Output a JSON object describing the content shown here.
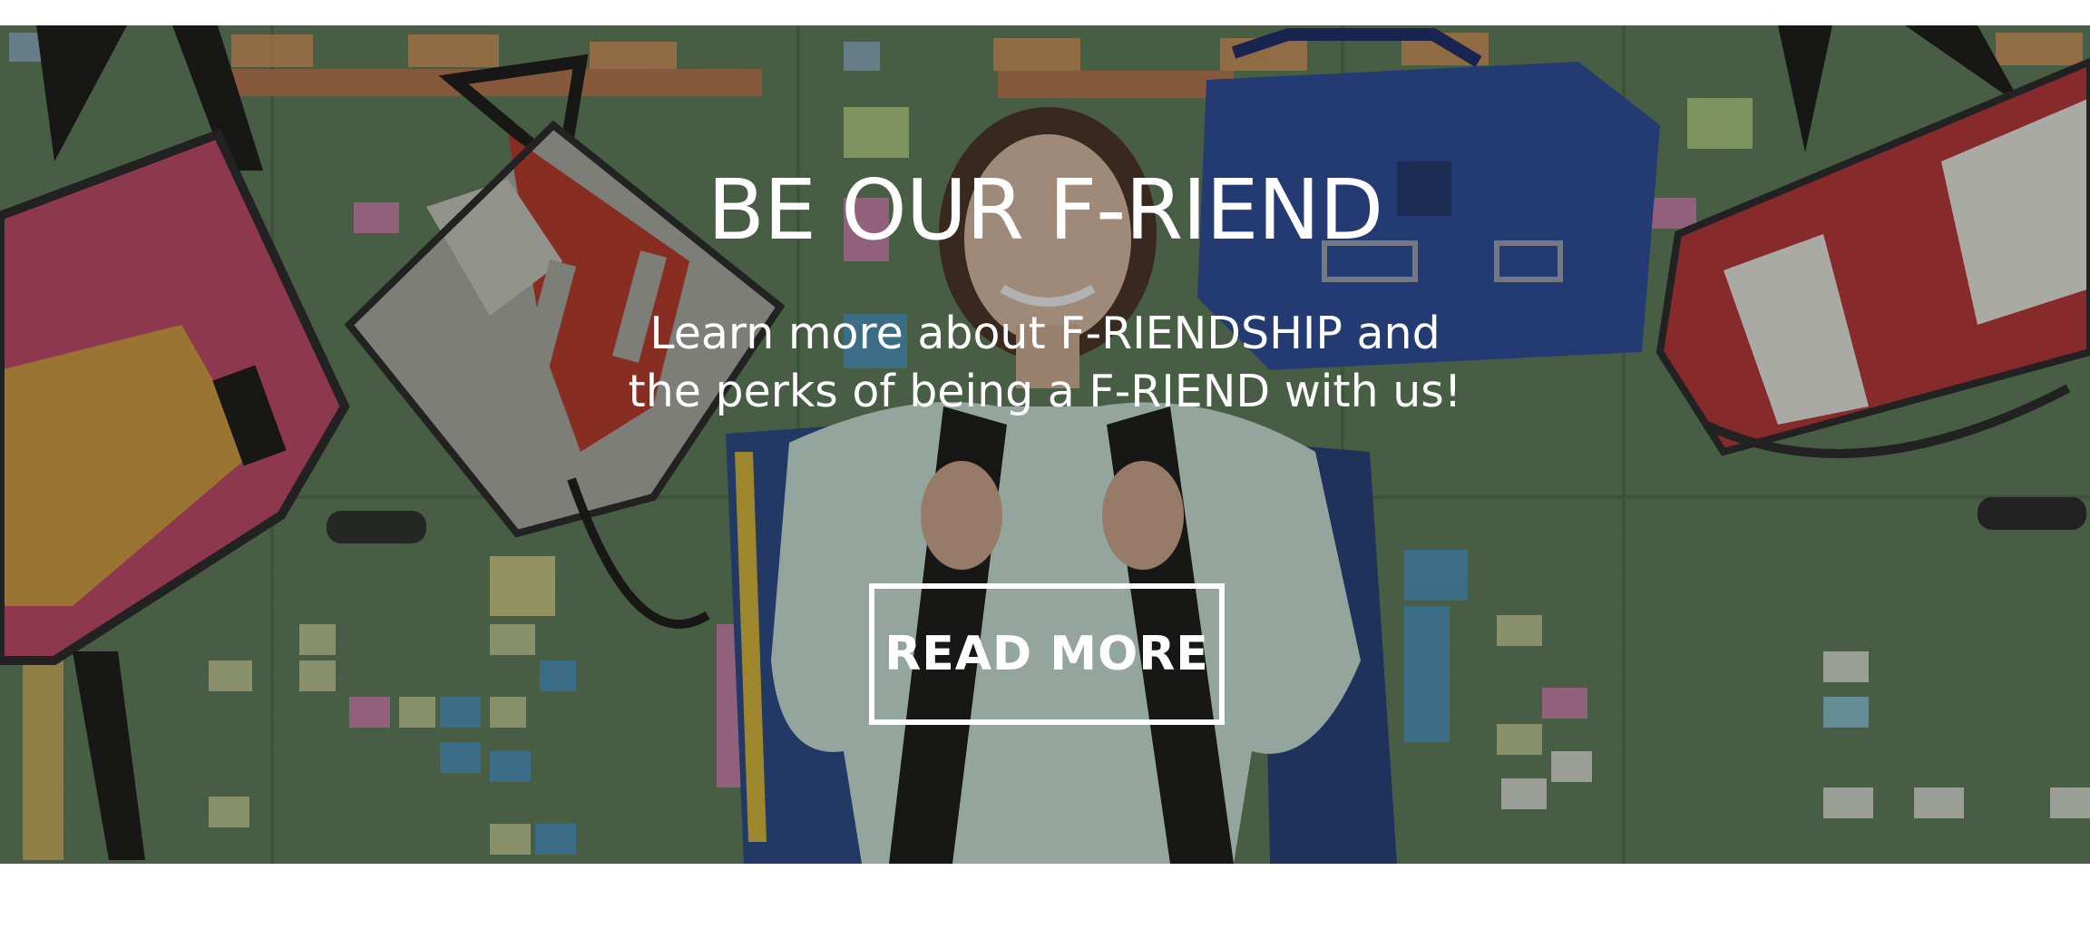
{
  "hero": {
    "title": "BE OUR F-RIEND",
    "subtitle_line1": "Learn more about F-RIENDSHIP and",
    "subtitle_line2": "the perks of being a F-RIEND with us!",
    "button_label": "READ MORE"
  },
  "colors": {
    "wall": "#5f7d5a",
    "text": "#ffffff"
  }
}
